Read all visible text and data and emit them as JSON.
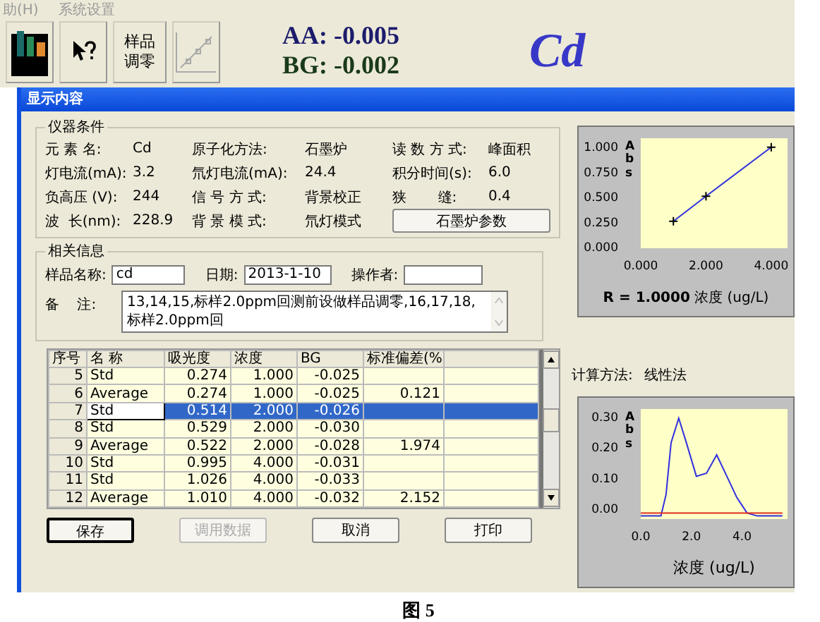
{
  "menu": [
    {
      "label": "助(H)"
    },
    {
      "label": "系统设置"
    }
  ],
  "toolbar": {
    "buttons": [
      {
        "kind": "bars"
      },
      {
        "kind": "help"
      },
      {
        "kind": "text",
        "label": "样品调零"
      },
      {
        "kind": "curve"
      }
    ],
    "readings": [
      {
        "label": "AA:",
        "value": "-0.005",
        "color": "#1c1c6c"
      },
      {
        "label": "BG:",
        "value": "-0.002",
        "color": "#1a3a1a"
      }
    ],
    "element": "Cd"
  },
  "dialog": {
    "title": "显示内容",
    "instrument": {
      "title": "仪器条件",
      "columns": [
        [
          {
            "label": "元 素 名:",
            "value": "Cd"
          },
          {
            "label": "灯电流(mA):",
            "value": "3.2"
          },
          {
            "label": "负高压 (V):",
            "value": "244"
          },
          {
            "label": "波  长(nm):",
            "value": "228.9"
          }
        ],
        [
          {
            "label": "原子化方法:",
            "value": "石墨炉"
          },
          {
            "label": "氘灯电流(mA):",
            "value": "24.4"
          },
          {
            "label": "信 号 方 式:",
            "value": "背景校正"
          },
          {
            "label": "背 景 模 式:",
            "value": "氘灯模式"
          }
        ],
        [
          {
            "label": "读 数 方 式:",
            "value": "峰面积"
          },
          {
            "label": "积分时间(s):",
            "value": "6.0"
          },
          {
            "label": "狭       缝:",
            "value": "0.4"
          }
        ]
      ],
      "button": "石墨炉参数"
    },
    "info": {
      "title": "相关信息",
      "sample_label": "样品名称:",
      "sample_value": "cd",
      "date_label": "日期:",
      "date_value": "2013-1-10",
      "operator_label": "操作者:",
      "notes_label": "备    注:",
      "notes_value": "13,14,15,标样2.0ppm回测前设做样品调零,16,17,18,标样2.0ppm回"
    },
    "table": {
      "columns": [
        "序号",
        "名 称",
        "吸光度",
        "浓度",
        "BG",
        "标准偏差(%"
      ],
      "rows": [
        {
          "no": "5",
          "name": "Std",
          "abs": "0.274",
          "conc": "1.000",
          "bg": "-0.025",
          "selected": false
        },
        {
          "no": "6",
          "name": "Average",
          "abs": "0.274",
          "conc": "1.000",
          "bg": "-0.025",
          "rsd": "0.121",
          "selected": false
        },
        {
          "no": "7",
          "name": "Std",
          "abs": "0.514",
          "conc": "2.000",
          "bg": "-0.026",
          "selected": true
        },
        {
          "no": "8",
          "name": "Std",
          "abs": "0.529",
          "conc": "2.000",
          "bg": "-0.030",
          "selected": false
        },
        {
          "no": "9",
          "name": "Average",
          "abs": "0.522",
          "conc": "2.000",
          "bg": "-0.028",
          "rsd": "1.974",
          "selected": false
        },
        {
          "no": "10",
          "name": "Std",
          "abs": "0.995",
          "conc": "4.000",
          "bg": "-0.031",
          "selected": false
        },
        {
          "no": "11",
          "name": "Std",
          "abs": "1.026",
          "conc": "4.000",
          "bg": "-0.033",
          "selected": false
        },
        {
          "no": "12",
          "name": "Average",
          "abs": "1.010",
          "conc": "4.000",
          "bg": "-0.032",
          "rsd": "2.152",
          "selected": false
        }
      ]
    },
    "buttons": [
      {
        "label": "保存",
        "disabled": false,
        "default": true
      },
      {
        "label": "调用数据",
        "disabled": true,
        "default": false
      },
      {
        "label": "取消",
        "disabled": false,
        "default": false
      },
      {
        "label": "打印",
        "disabled": false,
        "default": false
      }
    ],
    "calibration": {
      "r_value": "R = 1.0000",
      "chart_data": {
        "type": "line",
        "xlabel": "浓度 (ug/L)",
        "ylabel": "Abs",
        "x": [
          1,
          2,
          4
        ],
        "series": [
          {
            "color": "#3030e0",
            "marker": "plus",
            "values": [
              0.27,
              0.52,
              1.01
            ]
          }
        ],
        "xlim": [
          0,
          4.5
        ],
        "ylim": [
          0,
          1.1
        ],
        "xticks": [
          {
            "value": 0,
            "label": "0.000"
          },
          {
            "value": 2,
            "label": "2.000"
          },
          {
            "value": 4,
            "label": "4.000"
          }
        ],
        "yticks": [
          {
            "value": 0,
            "label": "0.000"
          },
          {
            "value": 0.25,
            "label": "0.250"
          },
          {
            "value": 0.5,
            "label": "0.500"
          },
          {
            "value": 0.75,
            "label": "0.750"
          },
          {
            "value": 1,
            "label": "1.000"
          }
        ]
      }
    },
    "calc_method": {
      "label": "计算方法:",
      "value": "线性法"
    },
    "peak": {
      "chart_data": {
        "type": "line",
        "xlabel": "浓度 (ug/L)",
        "ylabel": "Abs",
        "x": [
          0,
          0.8,
          1.0,
          1.2,
          1.5,
          1.8,
          2.2,
          2.6,
          3.0,
          3.4,
          3.8,
          4.2,
          4.6,
          5.6
        ],
        "series": [
          {
            "color": "#3030e0",
            "values": [
              -0.02,
              -0.02,
              0.05,
              0.22,
              0.3,
              0.22,
              0.11,
              0.12,
              0.18,
              0.11,
              0.04,
              -0.01,
              -0.02,
              -0.02
            ]
          },
          {
            "color": "#e03020",
            "values": [
              -0.01,
              -0.01,
              -0.01,
              -0.01,
              -0.01,
              -0.01,
              -0.01,
              -0.01,
              -0.01,
              -0.01,
              -0.01,
              -0.01,
              -0.01,
              -0.01
            ]
          }
        ],
        "xlim": [
          0,
          5.8
        ],
        "ylim": [
          -0.03,
          0.33
        ],
        "xticks": [
          {
            "value": 0,
            "label": "0.0"
          },
          {
            "value": 2,
            "label": "2.0"
          },
          {
            "value": 4,
            "label": "4.0"
          }
        ],
        "yticks": [
          {
            "value": 0,
            "label": "0.00"
          },
          {
            "value": 0.1,
            "label": "0.10"
          },
          {
            "value": 0.2,
            "label": "0.20"
          },
          {
            "value": 0.3,
            "label": "0.30"
          }
        ]
      }
    }
  },
  "caption": "图 5"
}
